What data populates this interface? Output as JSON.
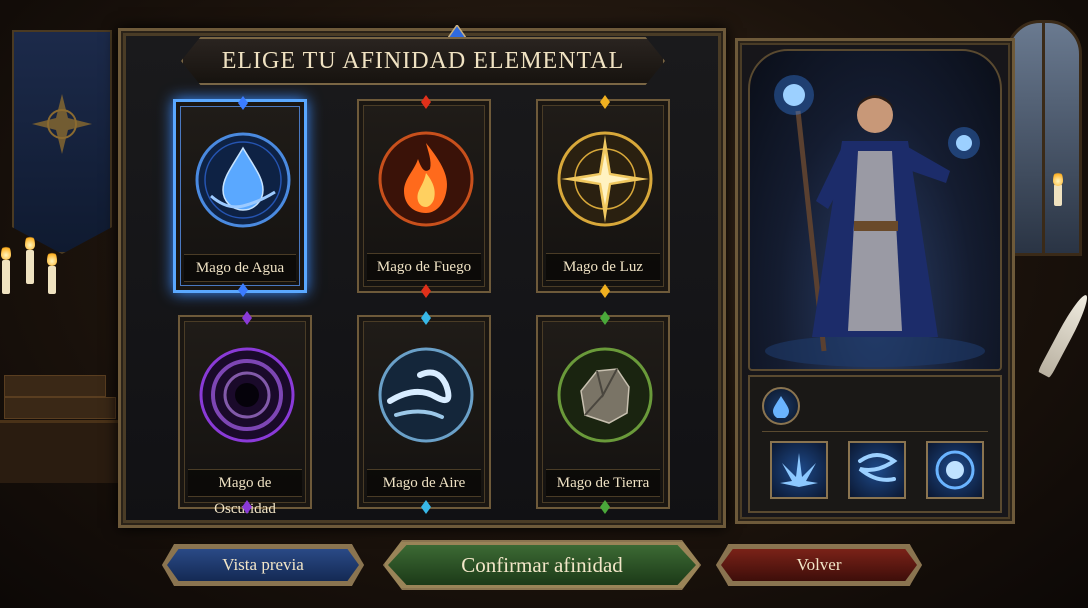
{
  "title": "Elige tu afinidad elemental",
  "selected_element": "water",
  "cards": [
    {
      "id": "water",
      "label": "Mago de Agua",
      "gem_color": "#3b7cff",
      "icon": "water-drop-icon"
    },
    {
      "id": "fire",
      "label": "Mago de Fuego",
      "gem_color": "#e0301a",
      "icon": "flame-icon"
    },
    {
      "id": "light",
      "label": "Mago de Luz",
      "gem_color": "#f0b020",
      "icon": "star-burst-icon"
    },
    {
      "id": "darkness",
      "label": "Mago de Oscuridad",
      "gem_color": "#8a3ad8",
      "icon": "vortex-icon"
    },
    {
      "id": "air",
      "label": "Mago de Aire",
      "gem_color": "#38b8e8",
      "icon": "wind-swirl-icon"
    },
    {
      "id": "earth",
      "label": "Mago de Tierra",
      "gem_color": "#4aa83a",
      "icon": "rock-icon"
    }
  ],
  "preview": {
    "element_badge_icon": "water-drop-icon",
    "abilities": [
      {
        "icon": "water-splash-icon"
      },
      {
        "icon": "water-wave-icon"
      },
      {
        "icon": "water-orb-icon"
      }
    ]
  },
  "buttons": {
    "preview": "Vista previa",
    "confirm": "Confirmar afinidad",
    "back": "Volver"
  },
  "colors": {
    "accent_selected": "#5aa8ff",
    "frame_gold": "#6e5a3a",
    "confirm_green": "#3c6a34",
    "back_red": "#7a2218",
    "preview_blue": "#2a4a86"
  }
}
